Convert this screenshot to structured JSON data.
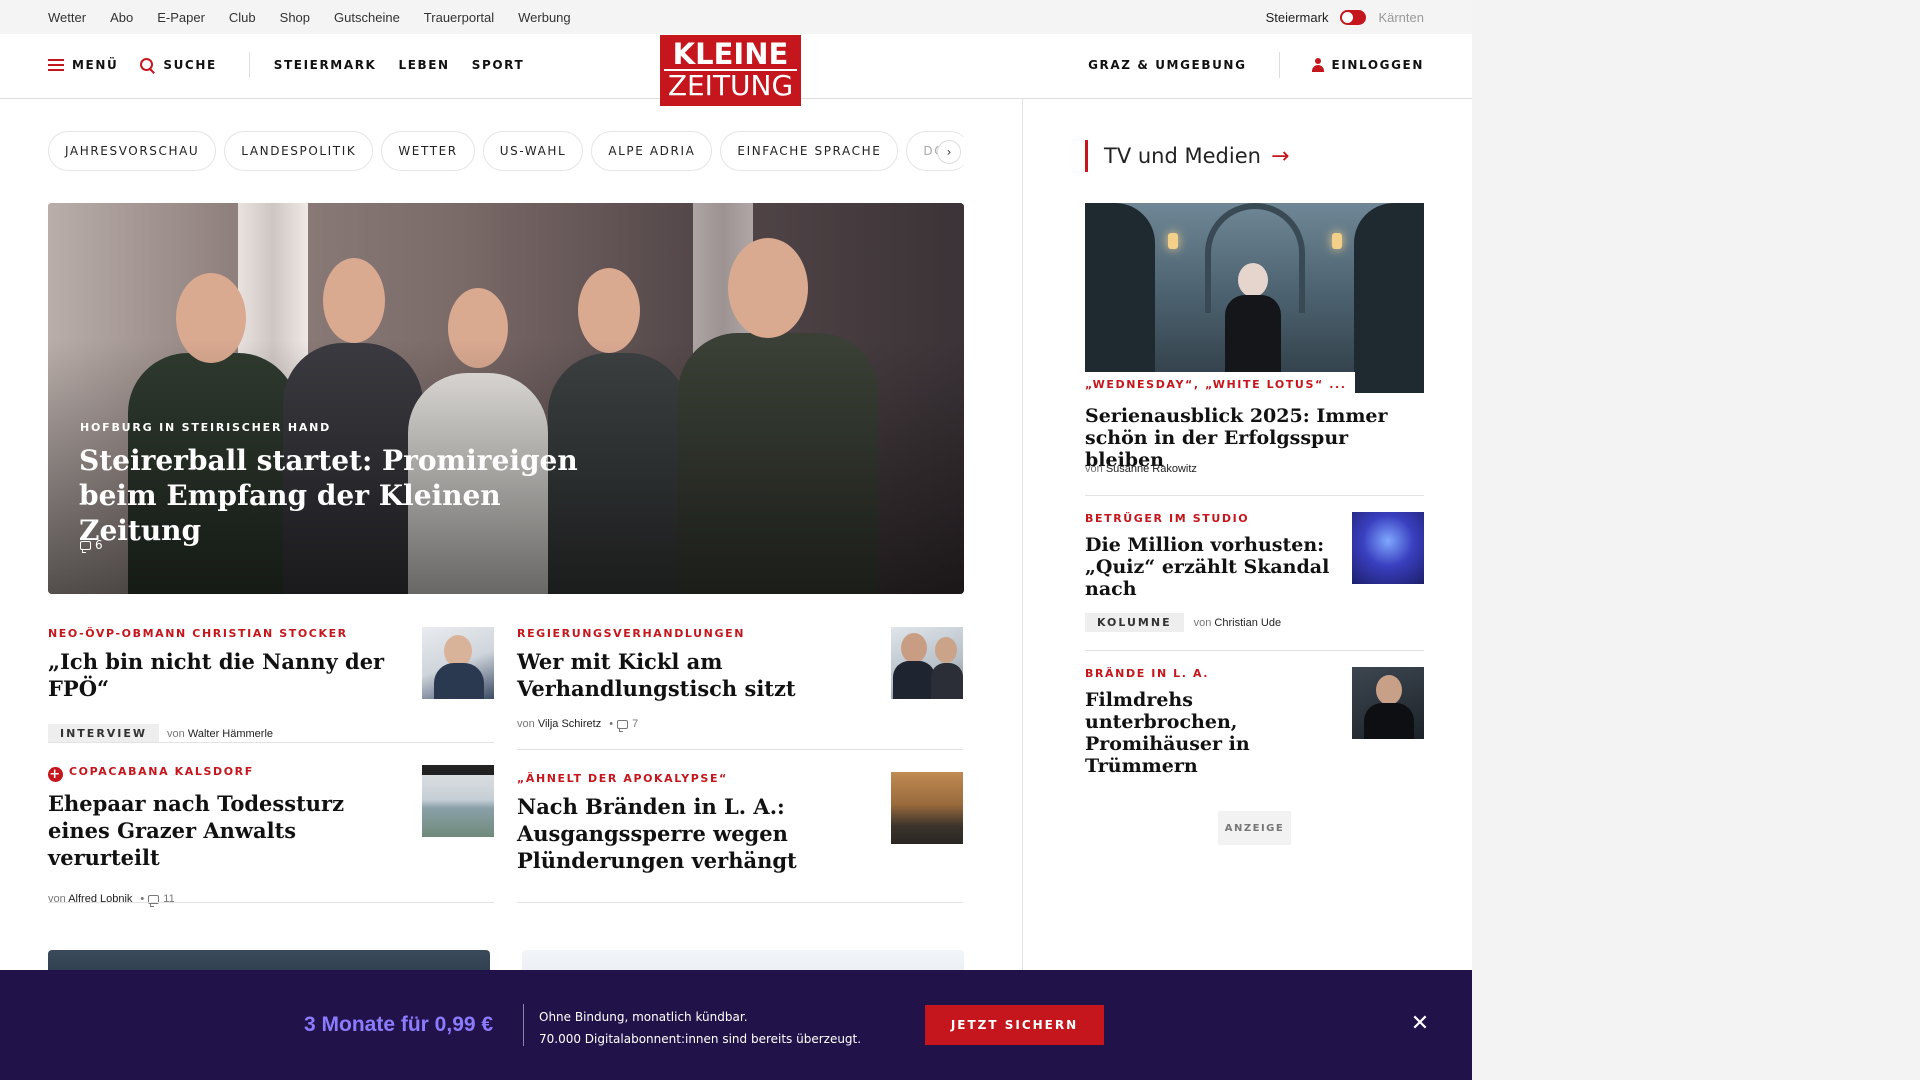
{
  "topbar": {
    "links": [
      "Wetter",
      "Abo",
      "E-Paper",
      "Club",
      "Shop",
      "Gutscheine",
      "Trauerportal",
      "Werbung"
    ],
    "region_active": "Steiermark",
    "region_other": "Kärnten"
  },
  "header": {
    "menu_label": "MENÜ",
    "search_label": "SUCHE",
    "nav": [
      "STEIERMARK",
      "LEBEN",
      "SPORT"
    ],
    "logo_line1": "KLEINE",
    "logo_line2": "ZEITUNG",
    "local_label": "GRAZ & UMGEBUNG",
    "login_label": "EINLOGGEN"
  },
  "chips": [
    "JAHRESVORSCHAU",
    "LANDESPOLITIK",
    "WETTER",
    "US-WAHL",
    "ALPE ADRIA",
    "EINFACHE SPRACHE",
    "DOS"
  ],
  "hero": {
    "kicker": "HOFBURG IN STEIRISCHER HAND",
    "title": "Steirerball startet: Promireigen beim Empfang der Kleinen Zeitung",
    "comments": "6"
  },
  "articles": [
    {
      "kicker": "NEO-ÖVP-OBMANN CHRISTIAN STOCKER",
      "headline": "„Ich bin nicht die Nanny der FPÖ“",
      "tag": "INTERVIEW",
      "by": "von",
      "author": "Walter Hämmerle"
    },
    {
      "kicker": "REGIERUNGSVERHANDLUNGEN",
      "headline": "Wer mit Kickl am Verhandlungstisch sitzt",
      "by": "von",
      "author": "Vilja Schiretz",
      "comments": "7"
    },
    {
      "kicker": "COPACABANA KALSDORF",
      "headline": "Ehepaar nach Todessturz eines Grazer Anwalts verurteilt",
      "by": "von",
      "author": "Alfred Lobnik",
      "comments": "11"
    },
    {
      "kicker": "„ÄHNELT DER APOKALYPSE“",
      "headline": "Nach Bränden in L. A.: Ausgangssperre wegen Plünderungen verhängt"
    }
  ],
  "sidebar": {
    "title": "TV und Medien",
    "hero_kicker": "„WEDNESDAY“, „WHITE LOTUS“ ...",
    "hero_headline": "Serienausblick 2025: Immer schön in der Erfolgsspur bleiben",
    "hero_by": "von",
    "hero_author": "Susanne Rakowitz",
    "items": [
      {
        "kicker": "BETRÜGER IM STUDIO",
        "headline": "Die Million vorhusten: „Quiz“ erzählt Skandal nach",
        "tag": "KOLUMNE",
        "by": "von",
        "author": "Christian Ude"
      },
      {
        "kicker": "BRÄNDE IN L. A.",
        "headline": "Filmdrehs unterbrochen, Promihäuser in Trümmern"
      }
    ],
    "ad_label": "ANZEIGE"
  },
  "banner": {
    "price": "3 Monate für 0,99 €",
    "line1": "Ohne Bindung, monatlich kündbar.",
    "line2": "70.000 Digitalabonnent:innen sind bereits überzeugt.",
    "cta": "JETZT SICHERN",
    "close_glyph": "✕"
  },
  "colors": {
    "brand_red": "#c4161c",
    "banner_bg": "#22124a",
    "banner_price": "#8b7cff"
  }
}
